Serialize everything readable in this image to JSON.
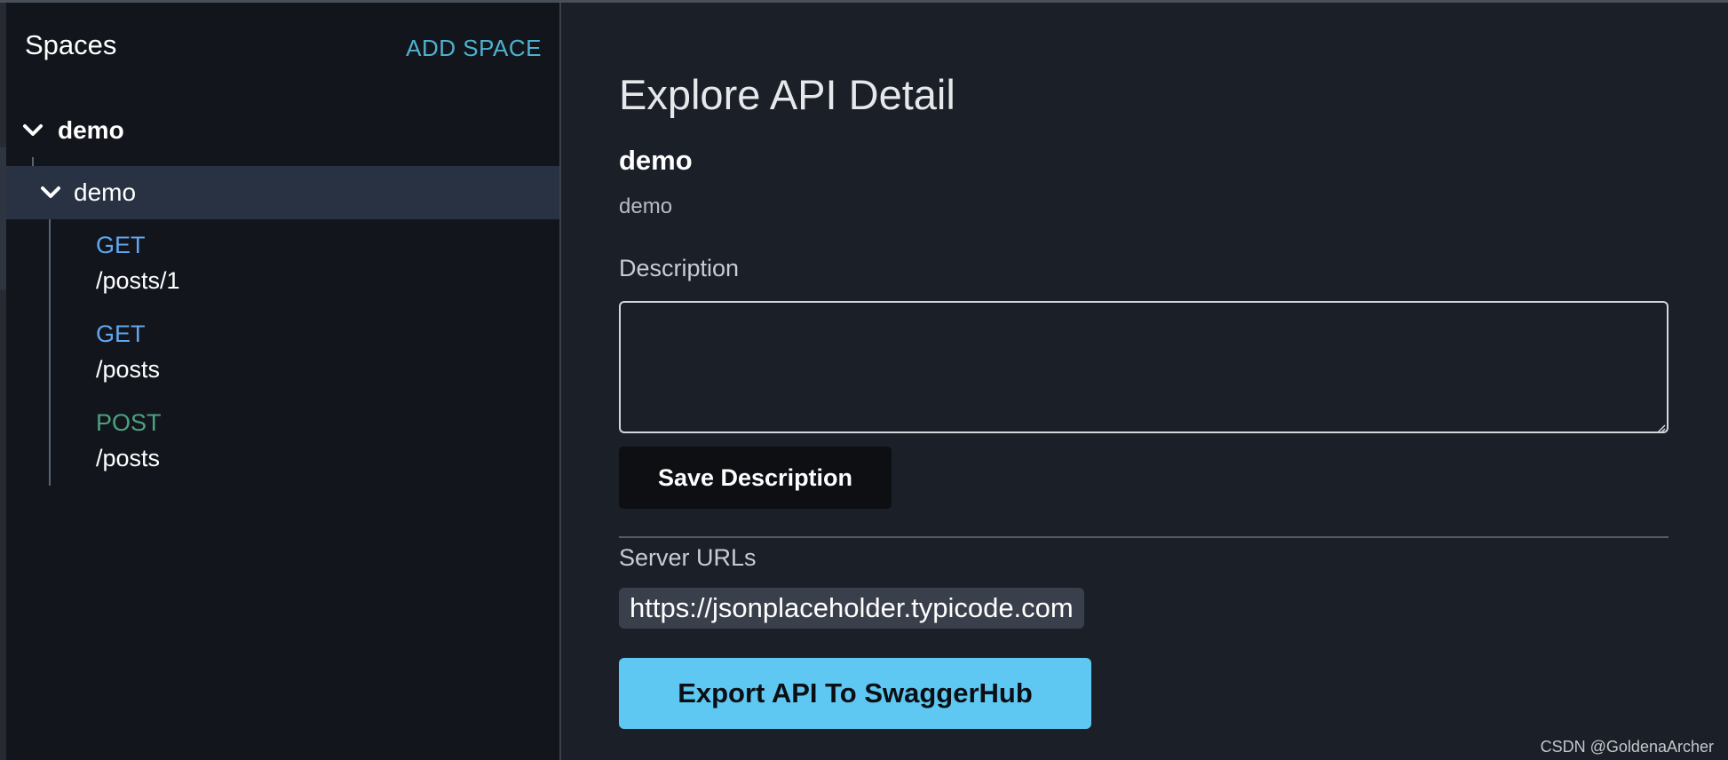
{
  "sidebar": {
    "title": "Spaces",
    "add_space_label": "ADD SPACE",
    "tree": {
      "root_label": "demo",
      "folder_label": "demo",
      "endpoints": [
        {
          "method": "GET",
          "path": "/posts/1"
        },
        {
          "method": "GET",
          "path": "/posts"
        },
        {
          "method": "POST",
          "path": "/posts"
        }
      ]
    }
  },
  "main": {
    "title": "Explore API Detail",
    "space_name": "demo",
    "space_subtitle": "demo",
    "description_label": "Description",
    "description_value": "",
    "save_label": "Save Description",
    "server_urls_label": "Server URLs",
    "server_url": "https://jsonplaceholder.typicode.com",
    "export_label": "Export API To SwaggerHub"
  },
  "watermark": "CSDN @GoldenaArcher",
  "colors": {
    "background": "#1b1f27",
    "sidebar_bg": "#12161c",
    "selected_bg": "#283242",
    "accent_link": "#4fb1cf",
    "method_get": "#61a6ee",
    "method_post": "#4fa07d",
    "export_button": "#5ec8f2"
  },
  "icons": {
    "expand": "chevron-down-icon"
  }
}
